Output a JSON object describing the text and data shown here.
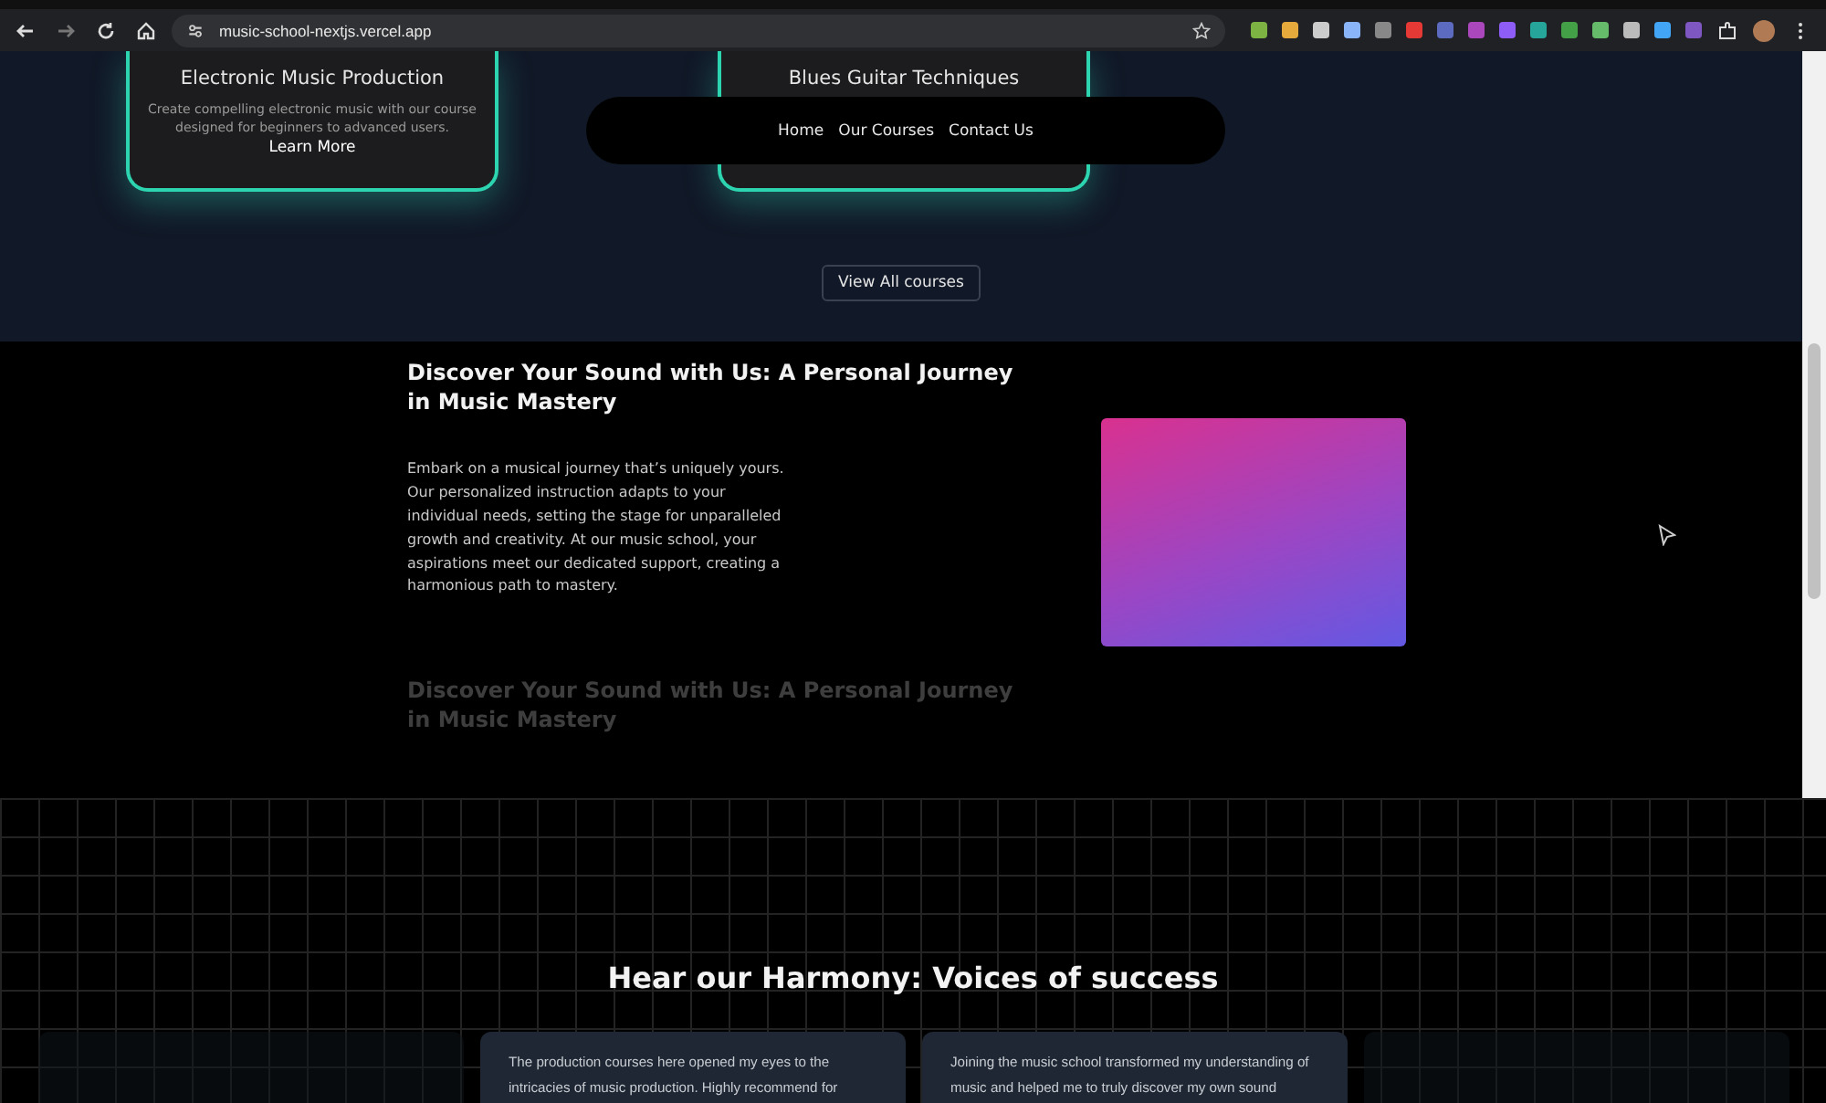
{
  "browser": {
    "url": "music-school-nextjs.vercel.app",
    "extensions": [
      {
        "color": "#7cb342"
      },
      {
        "color": "#e5a93c"
      },
      {
        "color": "#cccccc"
      },
      {
        "color": "#8ab4f8"
      },
      {
        "color": "#888888"
      },
      {
        "color": "#e53935"
      },
      {
        "color": "#5c6bc0"
      },
      {
        "color": "#ab47bc"
      },
      {
        "color": "#8e5cf6"
      },
      {
        "color": "#26a69a"
      },
      {
        "color": "#43a047"
      },
      {
        "color": "#66bb6a"
      },
      {
        "color": "#bbbbbb"
      },
      {
        "color": "#42a5f5"
      },
      {
        "color": "#7e57c2"
      }
    ]
  },
  "nav": {
    "links": [
      "Home",
      "Our Courses",
      "Contact Us"
    ]
  },
  "courses": [
    {
      "title": "Electronic Music Production",
      "description": "Create compelling electronic music with our course designed for beginners to advanced users.",
      "link": "Learn More"
    },
    {
      "title": "Blues Guitar Techniques"
    }
  ],
  "view_all_button": "View All courses",
  "feature": {
    "heading": "Discover Your Sound with Us: A Personal Journey in Music Mastery",
    "body": "Embark on a musical journey that’s uniquely yours. Our personalized instruction adapts to your individual needs, setting the stage for unparalleled growth and creativity. At our music school, your aspirations meet our dedicated support, creating a harmonious path to mastery.",
    "next_heading": "Discover Your Sound with Us: A Personal Journey in Music Mastery"
  },
  "testimonials": {
    "heading": "Hear our Harmony: Voices of success",
    "items": [
      {
        "faded": true
      },
      {
        "faded": false,
        "quote": "The production courses here opened my eyes to the intricacies of music production. Highly recommend for"
      },
      {
        "faded": false,
        "quote": "Joining the music school transformed my understanding of music and helped me to truly discover my own sound"
      },
      {
        "faded": true
      }
    ]
  }
}
